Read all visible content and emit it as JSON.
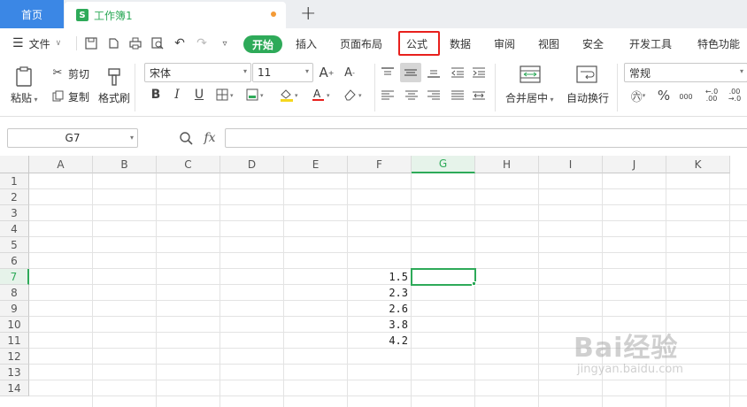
{
  "tabs": {
    "home": "首页",
    "doc": "工作簿1",
    "new_tab": "+"
  },
  "menu": {
    "file": "文件",
    "start": "开始",
    "items": [
      "插入",
      "页面布局",
      "公式",
      "数据",
      "审阅",
      "视图",
      "安全",
      "开发工具",
      "特色功能"
    ],
    "highlighted": "公式"
  },
  "ribbon": {
    "paste": "粘贴",
    "cut": "剪切",
    "copy": "复制",
    "format_painter": "格式刷",
    "font_name": "宋体",
    "font_size": "11",
    "bold": "B",
    "italic": "I",
    "underline": "U",
    "merge_center": "合并居中",
    "wrap_text": "自动换行",
    "number_format": "常规",
    "percent": "%",
    "thousands": "000"
  },
  "formula_bar": {
    "cell_ref": "G7",
    "fx": "fx",
    "value": ""
  },
  "columns": [
    "A",
    "B",
    "C",
    "D",
    "E",
    "F",
    "G",
    "H",
    "I",
    "J",
    "K"
  ],
  "rows": [
    "1",
    "2",
    "3",
    "4",
    "5",
    "6",
    "7",
    "8",
    "9",
    "10",
    "11",
    "12",
    "13",
    "14"
  ],
  "selected_cell": "G7",
  "cells": [
    {
      "ref": "F7",
      "value": "1.5"
    },
    {
      "ref": "F8",
      "value": "2.3"
    },
    {
      "ref": "F9",
      "value": "2.6"
    },
    {
      "ref": "F10",
      "value": "3.8"
    },
    {
      "ref": "F11",
      "value": "4.2"
    }
  ],
  "watermark": {
    "text": "Bai经验",
    "url": "jingyan.baidu.com"
  },
  "colors": {
    "accent": "#2eaa59",
    "home_tab": "#3b87e5",
    "highlight": "#e8201d"
  }
}
